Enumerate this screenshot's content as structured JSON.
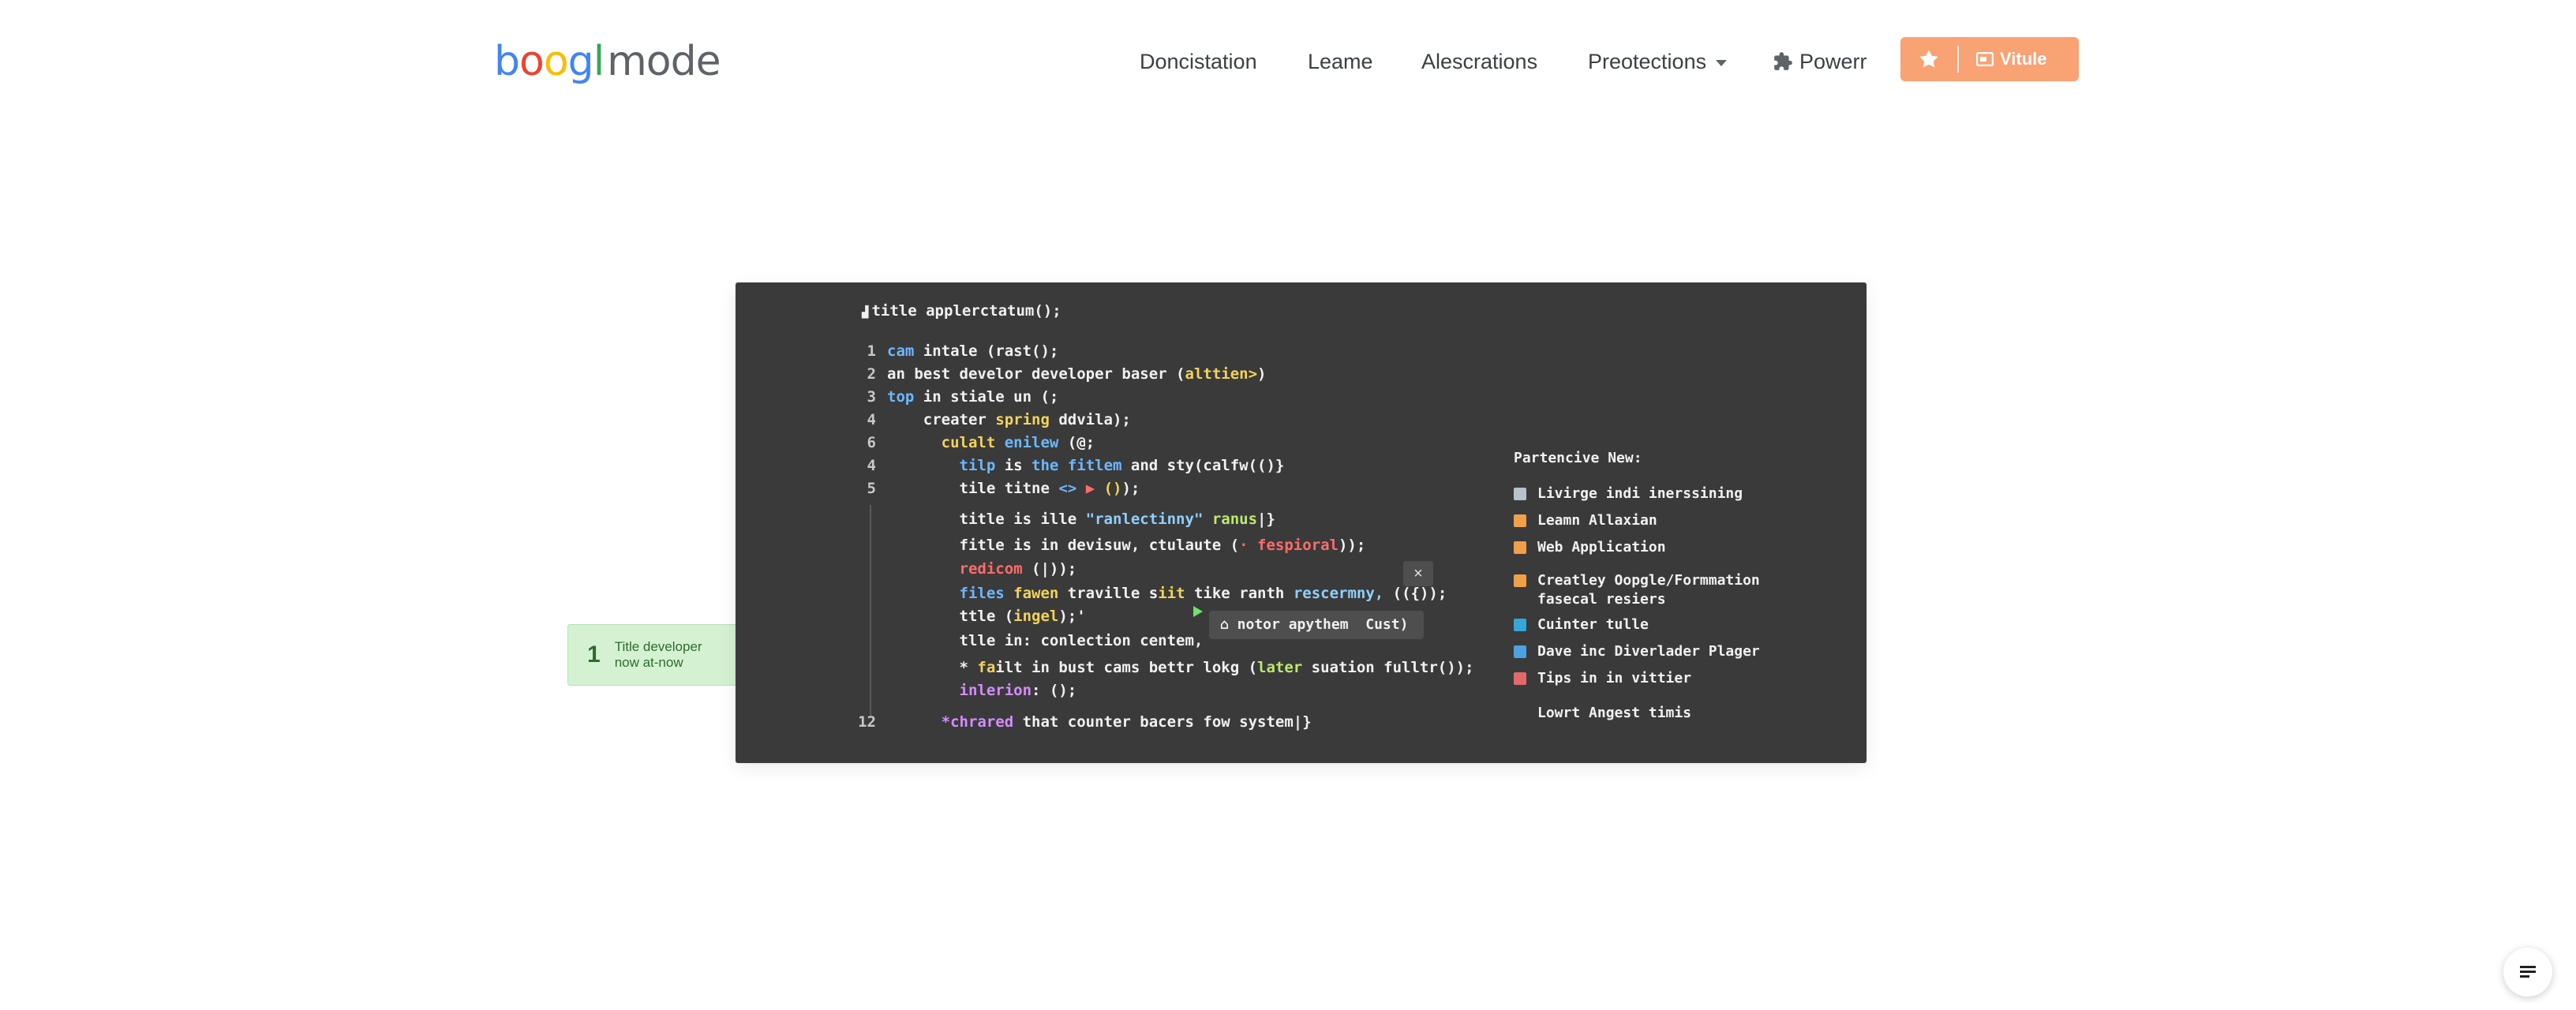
{
  "logo": {
    "letters": [
      {
        "ch": "b",
        "color": "#4285f4"
      },
      {
        "ch": "o",
        "color": "#ea4335"
      },
      {
        "ch": "o",
        "color": "#fbbc05"
      },
      {
        "ch": "g",
        "color": "#4285f4"
      },
      {
        "ch": "l",
        "color": "#34a853"
      }
    ],
    "suffix": "mode"
  },
  "nav": {
    "items": [
      "Doncistation",
      "Leame",
      "Alescrations",
      "Preotections"
    ],
    "powerr": "Powerr",
    "cta_label": "Vitule"
  },
  "code": {
    "header": "title applerctatum();",
    "lines": [
      {
        "n": "1",
        "t": [
          [
            "k-blue",
            "cam"
          ],
          [
            "",
            " intale (rast();"
          ]
        ]
      },
      {
        "n": "2",
        "t": [
          [
            "",
            "an best develor developer baser ("
          ],
          [
            "k-yel",
            "alttien>"
          ],
          [
            "",
            ")"
          ]
        ]
      },
      {
        "n": "3",
        "t": [
          [
            "k-blue",
            "top"
          ],
          [
            "",
            " in stiale un (;"
          ]
        ]
      },
      {
        "n": "4",
        "t": [
          [
            "",
            "    creater "
          ],
          [
            "k-yel",
            "spring"
          ],
          [
            "",
            " ddvila);"
          ]
        ]
      },
      {
        "n": "6",
        "t": [
          [
            "",
            "      "
          ],
          [
            "k-yel",
            "culalt"
          ],
          [
            "k-blue",
            " enilew"
          ],
          [
            "",
            " (@;"
          ]
        ]
      },
      {
        "n": "4",
        "t": [
          [
            "",
            "        "
          ],
          [
            "k-blue",
            "tilp"
          ],
          [
            "",
            " is "
          ],
          [
            "k-blue",
            "the"
          ],
          [
            "k-blue",
            " fitlem"
          ],
          [
            "",
            " and sty(calfw(()}"
          ]
        ]
      },
      {
        "n": "5",
        "t": [
          [
            "",
            "        tile titne "
          ],
          [
            "k-blue",
            "<>"
          ],
          [
            "",
            " "
          ],
          [
            "k-red",
            "▶"
          ],
          [
            "",
            " "
          ],
          [
            "k-yel",
            "()"
          ],
          [
            "",
            ");"
          ]
        ]
      },
      {
        "n": "",
        "t": [
          [
            "",
            "        title is ille "
          ],
          [
            "k-str",
            "\"ranlectinny\""
          ],
          [
            "",
            " "
          ],
          [
            "k-grn",
            "ranus"
          ],
          [
            "",
            "|}"
          ]
        ]
      },
      {
        "n": "",
        "t": [
          [
            "",
            "        fitle is in devisuw, ctulaute ("
          ],
          [
            "k-red",
            "· fespioral"
          ],
          [
            "",
            "));"
          ]
        ]
      },
      {
        "n": "",
        "t": [
          [
            "",
            "        "
          ],
          [
            "k-red",
            "redicom"
          ],
          [
            "",
            " (|));"
          ]
        ]
      },
      {
        "n": "",
        "t": [
          [
            "",
            "        "
          ],
          [
            "k-blue",
            "files"
          ],
          [
            "k-yel",
            " fawen"
          ],
          [
            "",
            " traville s"
          ],
          [
            "k-yel",
            "iit"
          ],
          [
            "",
            " tike ranth "
          ],
          [
            "k-str",
            "rescermny,"
          ],
          [
            "",
            " (({));"
          ]
        ]
      },
      {
        "n": "",
        "t": [
          [
            "",
            "        ttle ("
          ],
          [
            "k-yel",
            "ingel"
          ],
          [
            "",
            ");'"
          ]
        ]
      },
      {
        "n": "",
        "t": [
          [
            "",
            "        tlle in: conlection centem,"
          ]
        ]
      },
      {
        "n": "",
        "t": [
          [
            "",
            "        * "
          ],
          [
            "k-yel",
            "fa"
          ],
          [
            "",
            "ilt in bust cams bettr lokg ("
          ],
          [
            "k-grn",
            "later"
          ],
          [
            "",
            " suation fulltr());"
          ]
        ]
      },
      {
        "n": "",
        "t": [
          [
            "",
            "        "
          ],
          [
            "k-pur",
            "inlerion"
          ],
          [
            "",
            ": ();"
          ]
        ]
      },
      {
        "n": "12",
        "t": [
          [
            "",
            "      "
          ],
          [
            "k-pur",
            "*chrared"
          ],
          [
            "",
            " that counter bacers fow system|}"
          ]
        ]
      }
    ],
    "tooltip": "⌂ notor apythem  Cust)",
    "close": "×"
  },
  "side_panel": {
    "title": "Partencive New:",
    "items": [
      {
        "label": "Livirge indi inerssining",
        "color": "#b9c2cc"
      },
      {
        "label": "Leamn Allaxian",
        "color": "#f0a04a"
      },
      {
        "label": "Web Application",
        "color": "#f0a04a"
      },
      {
        "label": "Creatley Oopgle/Formmation fasecal resiers",
        "color": "#f0a04a"
      },
      {
        "label": "Cuinter tulle",
        "color": "#33a7d8"
      },
      {
        "label": "Dave inc Diverlader Plager",
        "color": "#4aa3e0"
      },
      {
        "label": "Tips in in vittier",
        "color": "#e06a6a"
      },
      {
        "label": "Lowrt Angest timis",
        "color": ""
      }
    ]
  },
  "card": {
    "number": "1",
    "line1": "Title developer",
    "line2": "now at-now"
  }
}
